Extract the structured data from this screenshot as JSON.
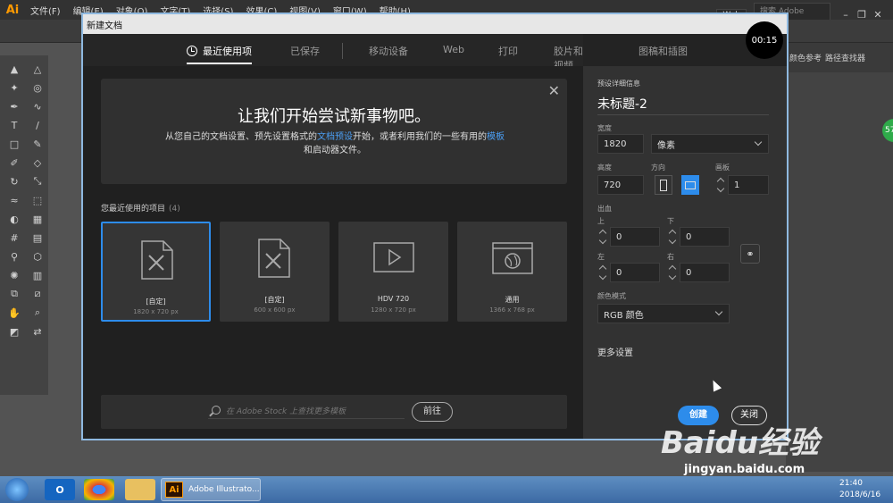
{
  "app": {
    "logo": "Ai",
    "menu": [
      "文件(F)",
      "编辑(E)",
      "对象(O)",
      "文字(T)",
      "选择(S)",
      "效果(C)",
      "视图(V)",
      "窗口(W)",
      "帮助(H)"
    ],
    "workspace": "Web",
    "stock_search_placeholder": "搜索 Adobe Stock",
    "right_panel_tabs": [
      "颜色参考",
      "路径查找器"
    ],
    "badge_count": "57"
  },
  "dialog": {
    "title": "新建文档",
    "timer": "00:15",
    "tabs": [
      {
        "label": "最近使用项",
        "active": true
      },
      {
        "label": "已保存"
      },
      {
        "label": "移动设备"
      },
      {
        "label": "Web"
      },
      {
        "label": "打印"
      },
      {
        "label": "胶片和视频"
      },
      {
        "label": "图稿和插图"
      }
    ],
    "promo": {
      "title": "让我们开始尝试新事物吧。",
      "text_1": "从您自己的文档设置、预先设置格式的",
      "link_1": "文档预设",
      "text_2": "开始，或者利用我们的一些有用的",
      "link_2": "模板",
      "text_3": "和启动器文件。"
    },
    "recent": {
      "label": "您最近使用的项目",
      "count": "(4)",
      "items": [
        {
          "name": "[自定]",
          "size": "1820 x 720 px",
          "icon": "artboard-icon",
          "selected": true
        },
        {
          "name": "[自定]",
          "size": "600 x 600 px",
          "icon": "artboard-icon"
        },
        {
          "name": "HDV 720",
          "size": "1280 x 720 px",
          "icon": "video-icon"
        },
        {
          "name": "通用",
          "size": "1366 x 768 px",
          "icon": "web-icon"
        }
      ]
    },
    "stock": {
      "placeholder": "在 Adobe Stock 上查找更多模板",
      "go_label": "前往"
    },
    "preset": {
      "section_label": "预设详细信息",
      "doc_name": "未标题-2",
      "width_label": "宽度",
      "width": "1820",
      "unit": "像素",
      "height_label": "高度",
      "height": "720",
      "orientation_label": "方向",
      "artboards_label": "画板",
      "artboards": "1",
      "bleed_label": "出血",
      "top_label": "上",
      "bottom_label": "下",
      "left_label": "左",
      "right_label": "右",
      "bleed_top": "0",
      "bleed_bottom": "0",
      "bleed_left": "0",
      "bleed_right": "0",
      "color_mode_label": "颜色模式",
      "color_mode": "RGB 颜色",
      "more_settings": "更多设置",
      "create": "创建",
      "close": "关闭"
    }
  },
  "taskbar": {
    "active_app": "Adobe Illustrato...",
    "time": "21:40",
    "date": "2018/6/16"
  },
  "watermark": {
    "brand": "Baidu经验",
    "url": "jingyan.baidu.com"
  }
}
